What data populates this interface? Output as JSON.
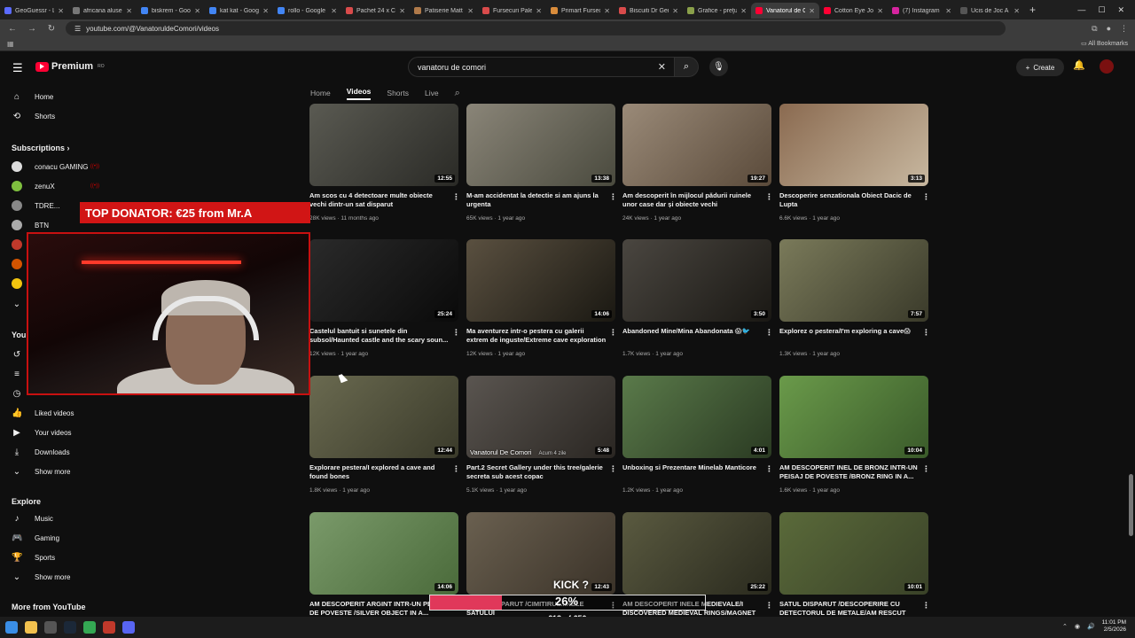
{
  "browser": {
    "tabs": [
      {
        "title": "GeoGuessr - Le",
        "color": "#5b6bff"
      },
      {
        "title": "africana aluse",
        "color": "#777777"
      },
      {
        "title": "biskrem - Goo",
        "color": "#4285f4"
      },
      {
        "title": "kat kat - Goog",
        "color": "#4285f4"
      },
      {
        "title": "rollo - Google",
        "color": "#4285f4"
      },
      {
        "title": "Pachet 24 x Ci",
        "color": "#d94b4b"
      },
      {
        "title": "Patiserie Matt",
        "color": "#b07a4a"
      },
      {
        "title": "Fursecuri Paleo",
        "color": "#d94b4b"
      },
      {
        "title": "Primart Fursec",
        "color": "#d98c3b"
      },
      {
        "title": "Biscuiti Dr Ger",
        "color": "#d94b4b"
      },
      {
        "title": "Grafice - preţu",
        "color": "#8aa04a"
      },
      {
        "title": "Vanatorul de C",
        "color": "#ff0033",
        "active": true
      },
      {
        "title": "Cotton Eye Joe",
        "color": "#ff0033"
      },
      {
        "title": "(7) Instagram",
        "color": "#d6249f"
      },
      {
        "title": "Ucis de Joc A",
        "color": "#555555"
      }
    ],
    "url": "youtube.com/@VanatoruldeComori/videos",
    "all_bookmarks": "All Bookmarks"
  },
  "header": {
    "logo_text": "Premium",
    "region": "RO",
    "search_value": "vanatoru de comori",
    "create_label": "Create"
  },
  "sidebar": {
    "main": [
      {
        "label": "Home",
        "icon": "home-icon",
        "glyph": "⌂"
      },
      {
        "label": "Shorts",
        "icon": "shorts-icon",
        "glyph": "⟲"
      }
    ],
    "subscriptions_heading": "Subscriptions",
    "subscriptions": [
      {
        "label": "conacu GAMING",
        "color": "#dddddd"
      },
      {
        "label": "zenuX",
        "color": "#7fbf3f"
      },
      {
        "label": "TDRE...",
        "color": "#888888"
      },
      {
        "label": "BTN",
        "color": "#aaaaaa"
      }
    ],
    "you_heading": "You",
    "you_items": [
      {
        "label": "Liked videos",
        "icon": "like-icon",
        "glyph": "👍"
      },
      {
        "label": "Your videos",
        "icon": "your-videos-icon",
        "glyph": "▶"
      },
      {
        "label": "Downloads",
        "icon": "download-icon",
        "glyph": "⤓"
      },
      {
        "label": "Show more",
        "icon": "chevron-down-icon",
        "glyph": "⌄"
      }
    ],
    "explore_heading": "Explore",
    "explore_items": [
      {
        "label": "Music",
        "icon": "music-icon",
        "glyph": "♪"
      },
      {
        "label": "Gaming",
        "icon": "gaming-icon",
        "glyph": "🎮"
      },
      {
        "label": "Sports",
        "icon": "trophy-icon",
        "glyph": "🏆"
      },
      {
        "label": "Show more",
        "icon": "chevron-down-icon",
        "glyph": "⌄"
      }
    ],
    "more_heading": "More from YouTube"
  },
  "channel_tabs": [
    "Home",
    "Videos",
    "Shorts",
    "Live"
  ],
  "active_tab": "Videos",
  "videos": [
    {
      "title": "Am scos cu 4 detectoare multe obiecte vechi dintr-un sat disparut",
      "views": "28K views",
      "age": "11 months ago",
      "duration": "12:55",
      "colors": [
        "#5a5a52",
        "#2a2a26"
      ]
    },
    {
      "title": "M-am accidentat la detectie si am ajuns la urgenta",
      "views": "65K views",
      "age": "1 year ago",
      "duration": "13:38",
      "colors": [
        "#8a8578",
        "#4a4a3e"
      ]
    },
    {
      "title": "Am descoperit în mijlocul pădurii ruinele unor case dar și obiecte vechi",
      "views": "24K views",
      "age": "1 year ago",
      "duration": "19:27",
      "colors": [
        "#9a8a78",
        "#5a4a3a"
      ]
    },
    {
      "title": "Descoperire senzationala Obiect Dacic de Lupta",
      "views": "6.6K views",
      "age": "1 year ago",
      "duration": "3:13",
      "colors": [
        "#8a6a50",
        "#c8b8a0"
      ]
    },
    {
      "title": "Castelul bantuit si sunetele din subsol/Haunted castle and the scary soun...",
      "views": "12K views",
      "age": "1 year ago",
      "duration": "25:24",
      "colors": [
        "#2a2a2a",
        "#0a0a0a"
      ]
    },
    {
      "title": "Ma aventurez intr-o pestera cu galerii extrem de inguste/Extreme cave exploration",
      "views": "12K views",
      "age": "1 year ago",
      "duration": "14:06",
      "colors": [
        "#5a5040",
        "#1a1812"
      ]
    },
    {
      "title": "Abandoned Mine/Mina Abandonata 😱🐦",
      "views": "1.7K views",
      "age": "1 year ago",
      "duration": "3:50",
      "colors": [
        "#4a4640",
        "#1a1814"
      ]
    },
    {
      "title": "Explorez o pestera/I'm exploring a cave😱",
      "views": "1.3K views",
      "age": "1 year ago",
      "duration": "7:57",
      "colors": [
        "#7a7a5a",
        "#3a3a2a"
      ]
    },
    {
      "title": "Explorare pestera/I explored a cave and found bones",
      "views": "1.8K views",
      "age": "1 year ago",
      "duration": "12:44",
      "colors": [
        "#6a6a50",
        "#3a3a2a"
      ]
    },
    {
      "title": "Part.2 Secret Gallery under this tree/galerie secreta sub acest copac",
      "views": "5.1K views",
      "age": "1 year ago",
      "duration": "5:48",
      "colors": [
        "#5a5550",
        "#2a2622"
      ]
    },
    {
      "title": "Unboxing si Prezentare Minelab Manticore",
      "views": "1.2K views",
      "age": "1 year ago",
      "duration": "4:01",
      "colors": [
        "#5a7a4a",
        "#2a3a22"
      ]
    },
    {
      "title": "AM DESCOPERIT INEL DE BRONZ INTR-UN PEISAJ DE POVESTE /BRONZ RING IN A...",
      "views": "1.6K views",
      "age": "1 year ago",
      "duration": "10:04",
      "colors": [
        "#6a9a4a",
        "#3a5a2a"
      ]
    },
    {
      "title": "AM DESCOPERIT ARGINT INTR-UN PEISAJ DE POVESTE /SILVER OBJECT IN A...",
      "views": "",
      "age": "",
      "duration": "14:06",
      "colors": [
        "#7a9a6a",
        "#4a6a3a"
      ]
    },
    {
      "title": "SATUL DISPARUT /CIMITIRUL...NELE SATULUI",
      "views": "",
      "age": "",
      "duration": "12:43",
      "colors": [
        "#6a6050",
        "#3a3228"
      ]
    },
    {
      "title": "AM DESCOPERIT INELE MEDIEVALE/I DISCOVERED MEDIEVAL RINGS/MAGNET",
      "views": "",
      "age": "",
      "duration": "25:22",
      "colors": [
        "#5a5a40",
        "#2a2a1e"
      ]
    },
    {
      "title": "SATUL DISPARUT /DESCOPERIRE CU DETECTORUL DE METALE/AM RESCUT CU...",
      "views": "",
      "age": "",
      "duration": "10:01",
      "colors": [
        "#5a6a3a",
        "#3a4228"
      ]
    }
  ],
  "overlay": {
    "donator": "TOP DONATOR: €25 from Mr.A",
    "thumb_watermark": "Vanatorul De Comori",
    "thumb_watermark_age": "Acum 4 zile",
    "goal_title": "KICK ?",
    "goal_percent": "26%",
    "goal_fraction": 0.26,
    "goal_amount": "€13 of €50"
  },
  "taskbar": {
    "time": "11:01 PM",
    "date": "2/5/2026"
  }
}
